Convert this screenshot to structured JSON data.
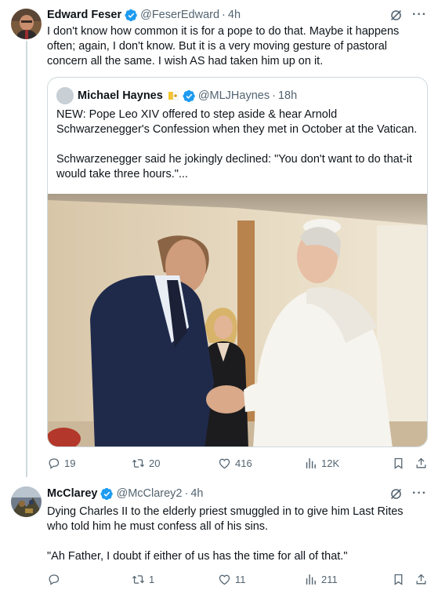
{
  "tweet1": {
    "name": "Edward Feser",
    "handle": "@FeserEdward",
    "time": "4h",
    "text": "I don't know how common it is for a pope to do that. Maybe it happens often; again, I don't know. But it is a very moving gesture of pastoral concern all the same. I wish AS had taken him up on it.",
    "quote": {
      "name": "Michael Haynes",
      "handle": "@MLJHaynes",
      "time": "18h",
      "paragraphs": [
        "NEW: Pope Leo XIV offered to step aside & hear Arnold Schwarzenegger's Confession when they met in October at the Vatican.",
        "Schwarzenegger said he jokingly declined: \"You don't want to do that-it would take three hours.\"..."
      ]
    },
    "actions": {
      "replies": "19",
      "reposts": "20",
      "likes": "416",
      "views": "12K"
    }
  },
  "tweet2": {
    "name": "McClarey",
    "handle": "@McClarey2",
    "time": "4h",
    "paragraphs": [
      "Dying Charles II to the elderly priest smuggled in to give him Last Rites who told him he must confess all of his sins.",
      "\"Ah Father, I doubt if either of us has the time for all of that.\""
    ],
    "actions": {
      "replies": "",
      "reposts": "1",
      "likes": "11",
      "views": "211"
    }
  },
  "ui": {
    "dot": "·",
    "colors": {
      "text": "#0f1419",
      "secondary": "#536471",
      "verified": "#1d9bf0",
      "border": "#cfd9de"
    },
    "icons": [
      "verified-badge-icon",
      "grok-icon",
      "more-icon",
      "reply-icon",
      "repost-icon",
      "like-icon",
      "views-icon",
      "bookmark-icon",
      "share-icon",
      "pinned-flag-emoji-icon"
    ]
  }
}
